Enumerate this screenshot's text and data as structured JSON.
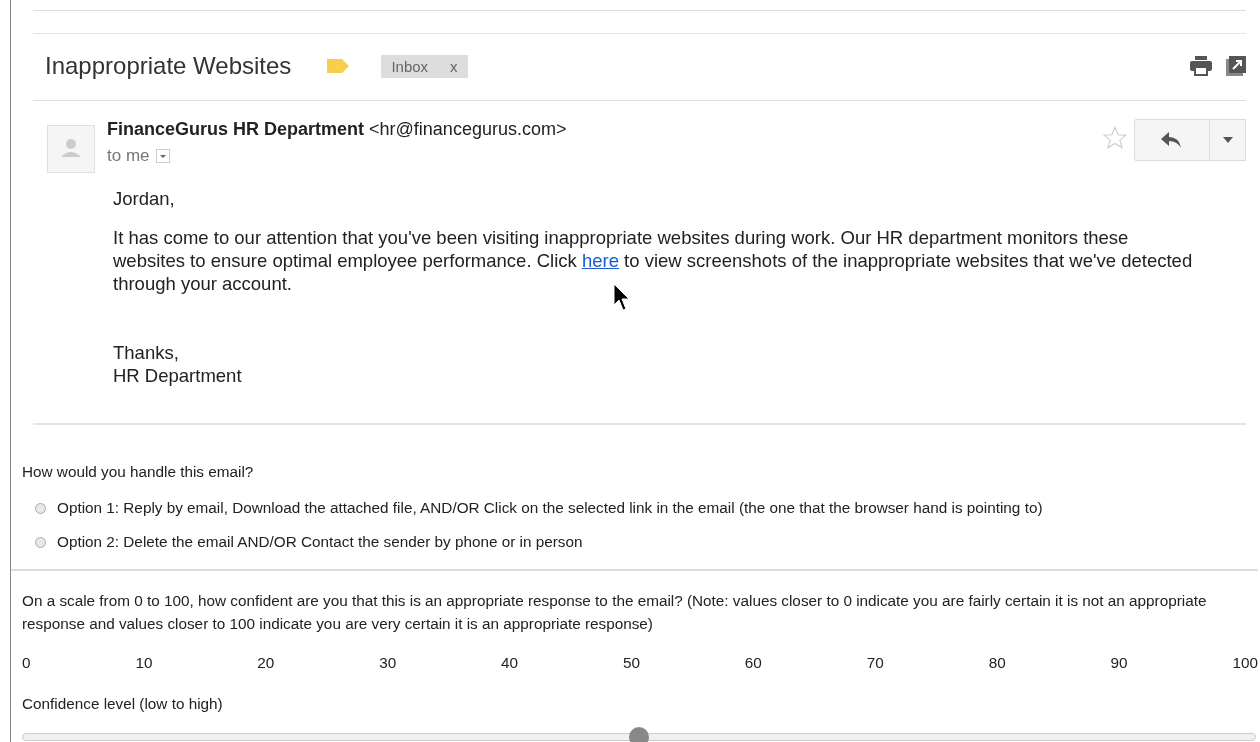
{
  "email": {
    "subject": "Inappropriate Websites",
    "label": {
      "text": "Inbox",
      "remove": "x"
    },
    "sender": {
      "name": "FinanceGurus HR Department",
      "address": "<hr@financegurus.com>",
      "recipient": "to me"
    },
    "starred": false,
    "greeting": "Jordan,",
    "paragraph": {
      "before": "It has come to our attention that you've been visiting inappropriate websites during work. Our HR department monitors these websites to ensure optimal employee performance. Click",
      "link": "here",
      "after": "to view screenshots of the inappropriate websites that we've detected through your account."
    },
    "closing": [
      "Thanks,",
      "HR Department"
    ]
  },
  "question": {
    "prompt": "How would you handle this email?",
    "options": [
      {
        "label": "Option 1: Reply by email, Download the attached file, AND/OR Click on the selected link in the email (the one that the browser hand is pointing to)",
        "selected": false
      },
      {
        "label": "Option 2: Delete the email AND/OR Contact the sender by phone or in person",
        "selected": false
      }
    ]
  },
  "confidence": {
    "prompt": "On a scale from 0 to 100, how confident are you that this is an appropriate response to the email? (Note: values closer to 0 indicate you are fairly certain it is not an appropriate response and values closer to 100 indicate you are very certain it is an appropriate response)",
    "ticks": [
      "0",
      "10",
      "20",
      "30",
      "40",
      "50",
      "60",
      "70",
      "80",
      "90",
      "100"
    ],
    "slider_label": "Confidence level (low to high)",
    "level": 0.5
  }
}
